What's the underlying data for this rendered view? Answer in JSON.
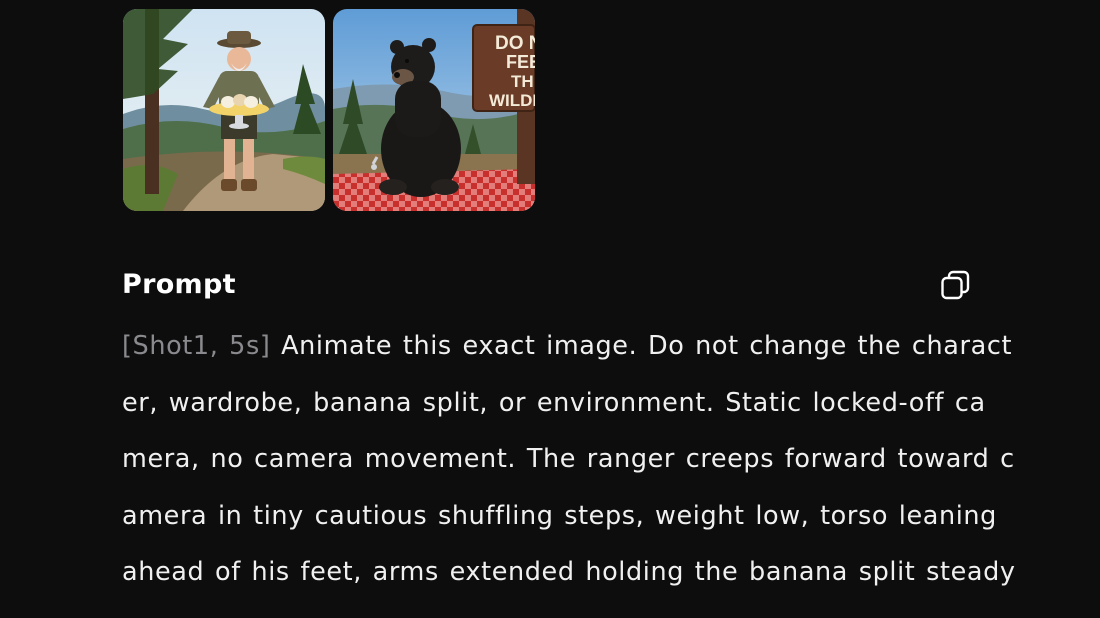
{
  "images": [
    {
      "name": "ranger-thumbnail"
    },
    {
      "name": "bear-thumbnail",
      "sign_lines": [
        "DO N",
        "FEE",
        "TH",
        "WILDI"
      ]
    }
  ],
  "prompt": {
    "title": "Prompt",
    "copy_icon": "copy-icon",
    "shot_tag": "[Shot1, 5s]",
    "lines": [
      " Animate this exact image. Do not change the charact",
      "er, wardrobe, banana split, or environment. Static locked-off ca",
      "mera, no camera movement. The ranger creeps forward toward c",
      "amera in tiny cautious shuffling steps, weight low, torso leaning",
      "ahead of his feet, arms extended holding the banana split steady"
    ]
  },
  "colors": {
    "background": "#0d0d0e",
    "text": "#f0f0f0",
    "muted": "#8a8a8e"
  }
}
